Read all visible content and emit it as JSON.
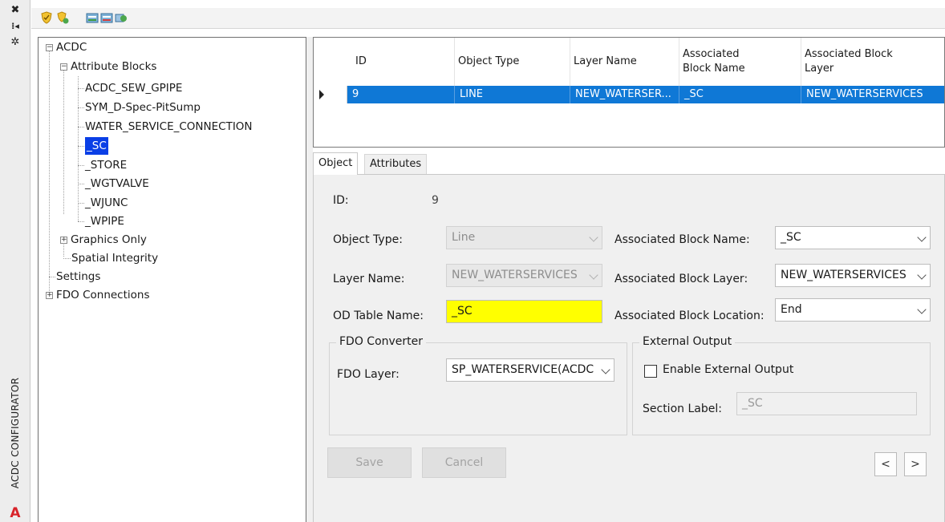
{
  "strip": {
    "close_glyph": "✖",
    "pin_glyph": "⁞◂",
    "settings_glyph": "✲",
    "title": "ACDC CONFIGURATOR",
    "logo_letter": "A"
  },
  "toolbar": {
    "icons": [
      "shield-icon",
      "shield-refresh-icon",
      "import-icon",
      "export-icon",
      "sync-icon"
    ]
  },
  "tree": {
    "root": "ACDC",
    "attribute_blocks": "Attribute Blocks",
    "blocks": [
      "ACDC_SEW_GPIPE",
      "SYM_D-Spec-PitSump",
      "WATER_SERVICE_CONNECTION",
      "_SC",
      "_STORE",
      "_WGTVALVE",
      "_WJUNC",
      "_WPIPE"
    ],
    "graphics_only": "Graphics Only",
    "spatial_integrity": "Spatial Integrity",
    "settings": "Settings",
    "fdo_connections": "FDO Connections",
    "expand_plus": "+",
    "expand_minus": "−"
  },
  "grid": {
    "headers": [
      "ID",
      "Object Type",
      "Layer Name",
      "Associated Block Name",
      "Associated Block Layer"
    ],
    "row": [
      "9",
      "LINE",
      "NEW_WATERSER...",
      "_SC",
      "NEW_WATERSERVICES"
    ]
  },
  "tabs": [
    "Object",
    "Attributes"
  ],
  "form": {
    "id_label": "ID:",
    "id_value": "9",
    "object_type_label": "Object Type:",
    "object_type_value": "Line",
    "layer_name_label": "Layer Name:",
    "layer_name_value": "NEW_WATERSERVICES",
    "od_table_label": "OD Table Name:",
    "od_table_value": "_SC",
    "assoc_block_name_label": "Associated Block Name:",
    "assoc_block_name_value": "_SC",
    "assoc_block_layer_label": "Associated Block Layer:",
    "assoc_block_layer_value": "NEW_WATERSERVICES",
    "assoc_block_location_label": "Associated Block Location:",
    "assoc_block_location_value": "End",
    "fdo_converter_title": "FDO Converter",
    "fdo_layer_label": "FDO Layer:",
    "fdo_layer_value": "SP_WATERSERVICE(ACDC",
    "external_output_title": "External Output",
    "enable_external_label": "Enable External Output",
    "section_label_label": "Section Label:",
    "section_label_value": "_SC",
    "save_label": "Save",
    "cancel_label": "Cancel",
    "prev_label": "<",
    "next_label": ">"
  },
  "colors": {
    "selection": "#0f78d6",
    "tree_selection": "#0a3fe6",
    "highlight_field": "#ffff00",
    "brand_red": "#d8232a"
  }
}
